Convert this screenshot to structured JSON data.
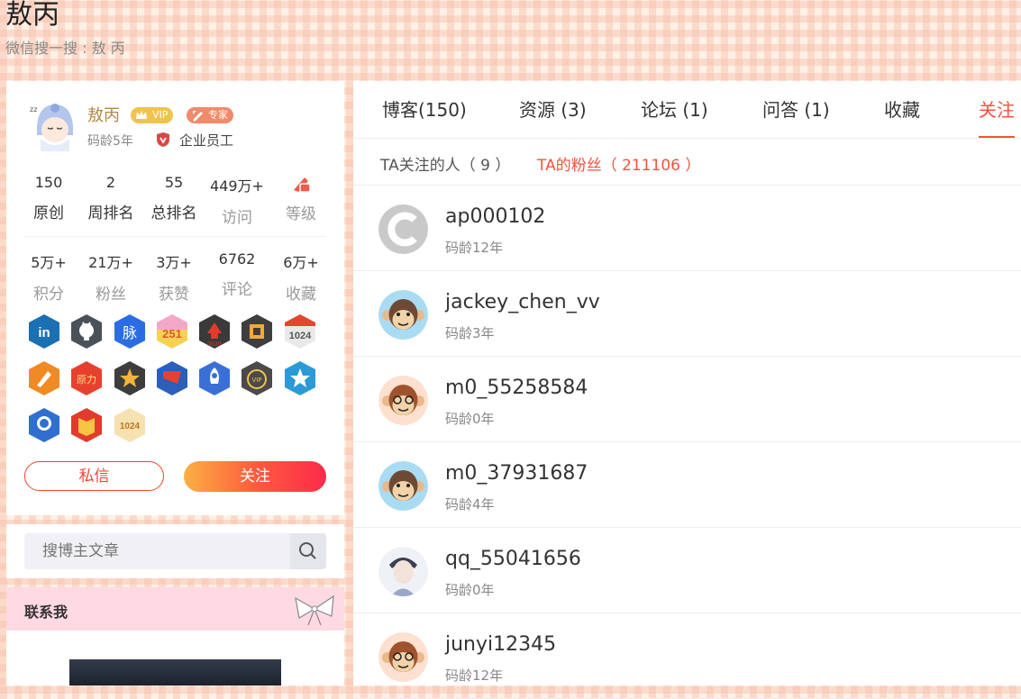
{
  "header": {
    "title": "敖丙",
    "subtitle": "微信搜一搜 : 敖 丙"
  },
  "profile": {
    "name": "敖丙",
    "vip_label": "VIP",
    "expert_label": "专家",
    "code_age": "码龄5年",
    "role": "企业员工",
    "stats_row1": [
      {
        "value": "150",
        "label": "原创"
      },
      {
        "value": "2",
        "label": "周排名"
      },
      {
        "value": "55",
        "label": "总排名"
      },
      {
        "value": "449万+",
        "label": "访问"
      },
      {
        "value": "",
        "label": "等级"
      }
    ],
    "stats_row2": [
      {
        "value": "5万+",
        "label": "积分"
      },
      {
        "value": "21万+",
        "label": "粉丝"
      },
      {
        "value": "3万+",
        "label": "获赞"
      },
      {
        "value": "6762",
        "label": "评论"
      },
      {
        "value": "6万+",
        "label": "收藏"
      }
    ],
    "badges": [
      "linkedin-badge",
      "github-badge",
      "maimai-badge",
      "blog-251-badge",
      "2020-badge",
      "gaoneng-badge",
      "1024-badge",
      "pen-badge",
      "yuanli-badge",
      "star-badge",
      "red-flag-badge",
      "rocket-badge",
      "vip-badge",
      "blue-star-badge",
      "astronaut-badge",
      "red-book-badge",
      "1024-gold-badge"
    ],
    "message_button": "私信",
    "follow_button": "关注"
  },
  "search": {
    "placeholder": "搜博主文章"
  },
  "contact": {
    "title": "联系我"
  },
  "tabs": [
    {
      "label": "博客(150)"
    },
    {
      "label": "资源 (3)"
    },
    {
      "label": "论坛 (1)"
    },
    {
      "label": "问答 (1)"
    },
    {
      "label": "收藏"
    },
    {
      "label": "关注"
    }
  ],
  "subtabs": {
    "following": "TA关注的人（ 9 ）",
    "fans": "TA的粉丝（ 211106 ）"
  },
  "fans": [
    {
      "name": "ap000102",
      "age": "码龄12年",
      "avatar": "csdn-logo"
    },
    {
      "name": "jackey_chen_vv",
      "age": "码龄3年",
      "avatar": "monkey-blue"
    },
    {
      "name": "m0_55258584",
      "age": "码龄0年",
      "avatar": "monkey-orange"
    },
    {
      "name": "m0_37931687",
      "age": "码龄4年",
      "avatar": "monkey-blue"
    },
    {
      "name": "qq_55041656",
      "age": "码龄0年",
      "avatar": "photo"
    },
    {
      "name": "junyi12345",
      "age": "码龄12年",
      "avatar": "monkey-orange"
    }
  ],
  "colors": {
    "accent": "#f4513f",
    "gold": "#b08a3e"
  }
}
